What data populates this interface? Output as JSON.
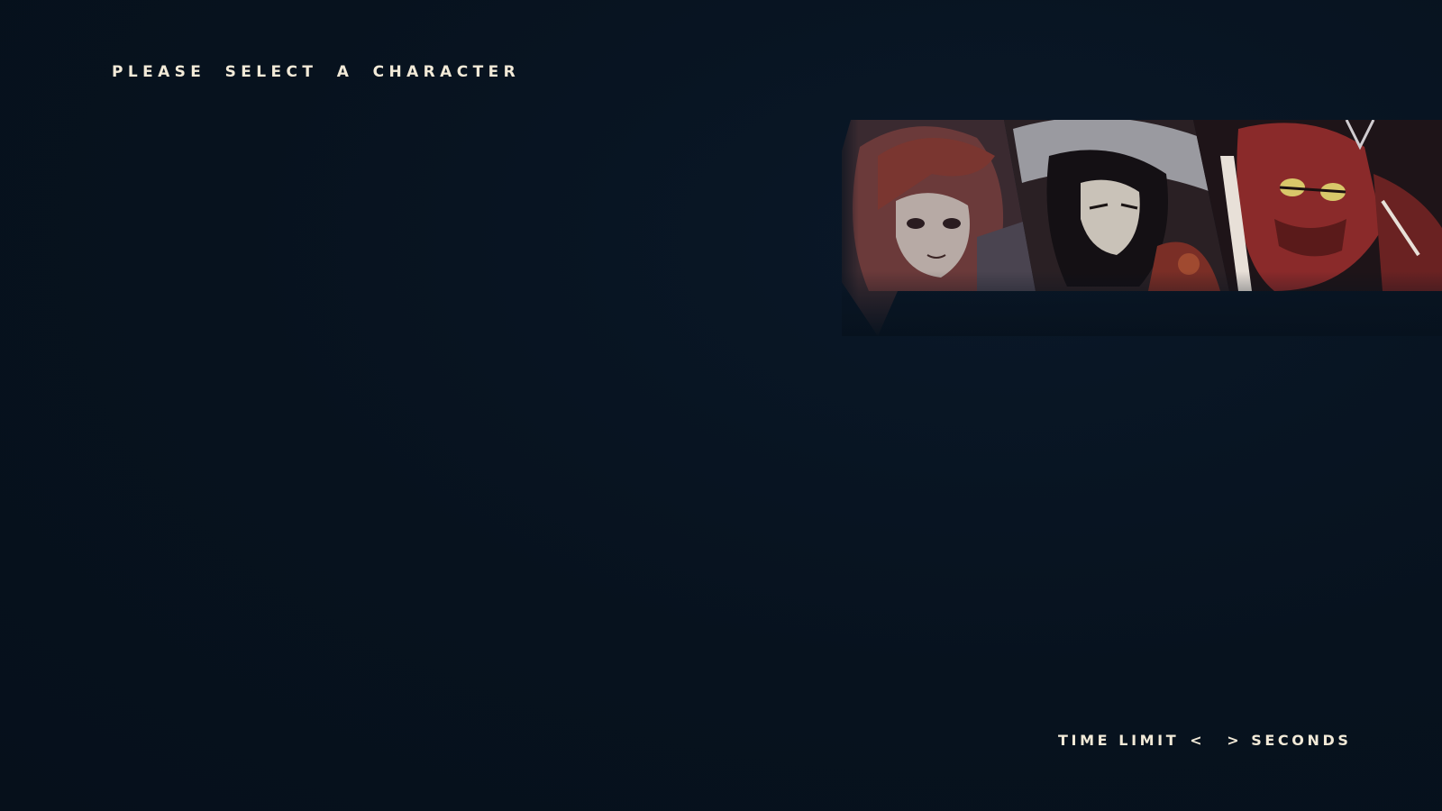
{
  "screen": {
    "heading": "PLEASE SELECT A CHARACTER"
  },
  "roster": {
    "characters": [
      {
        "id": "char-1",
        "desc": "red-haired-girl-portrait"
      },
      {
        "id": "char-2",
        "desc": "dark-haired-hooded-swordsman-portrait"
      },
      {
        "id": "char-3",
        "desc": "red-masked-goggles-brawler-portrait"
      }
    ]
  },
  "time_limit": {
    "label": "TIME LIMIT",
    "decrement": "<",
    "value": "",
    "increment": ">",
    "unit": "SECONDS"
  },
  "colors": {
    "background": "#07121e",
    "text": "#f2ead8",
    "portrait_red": "#8a2a2a"
  }
}
